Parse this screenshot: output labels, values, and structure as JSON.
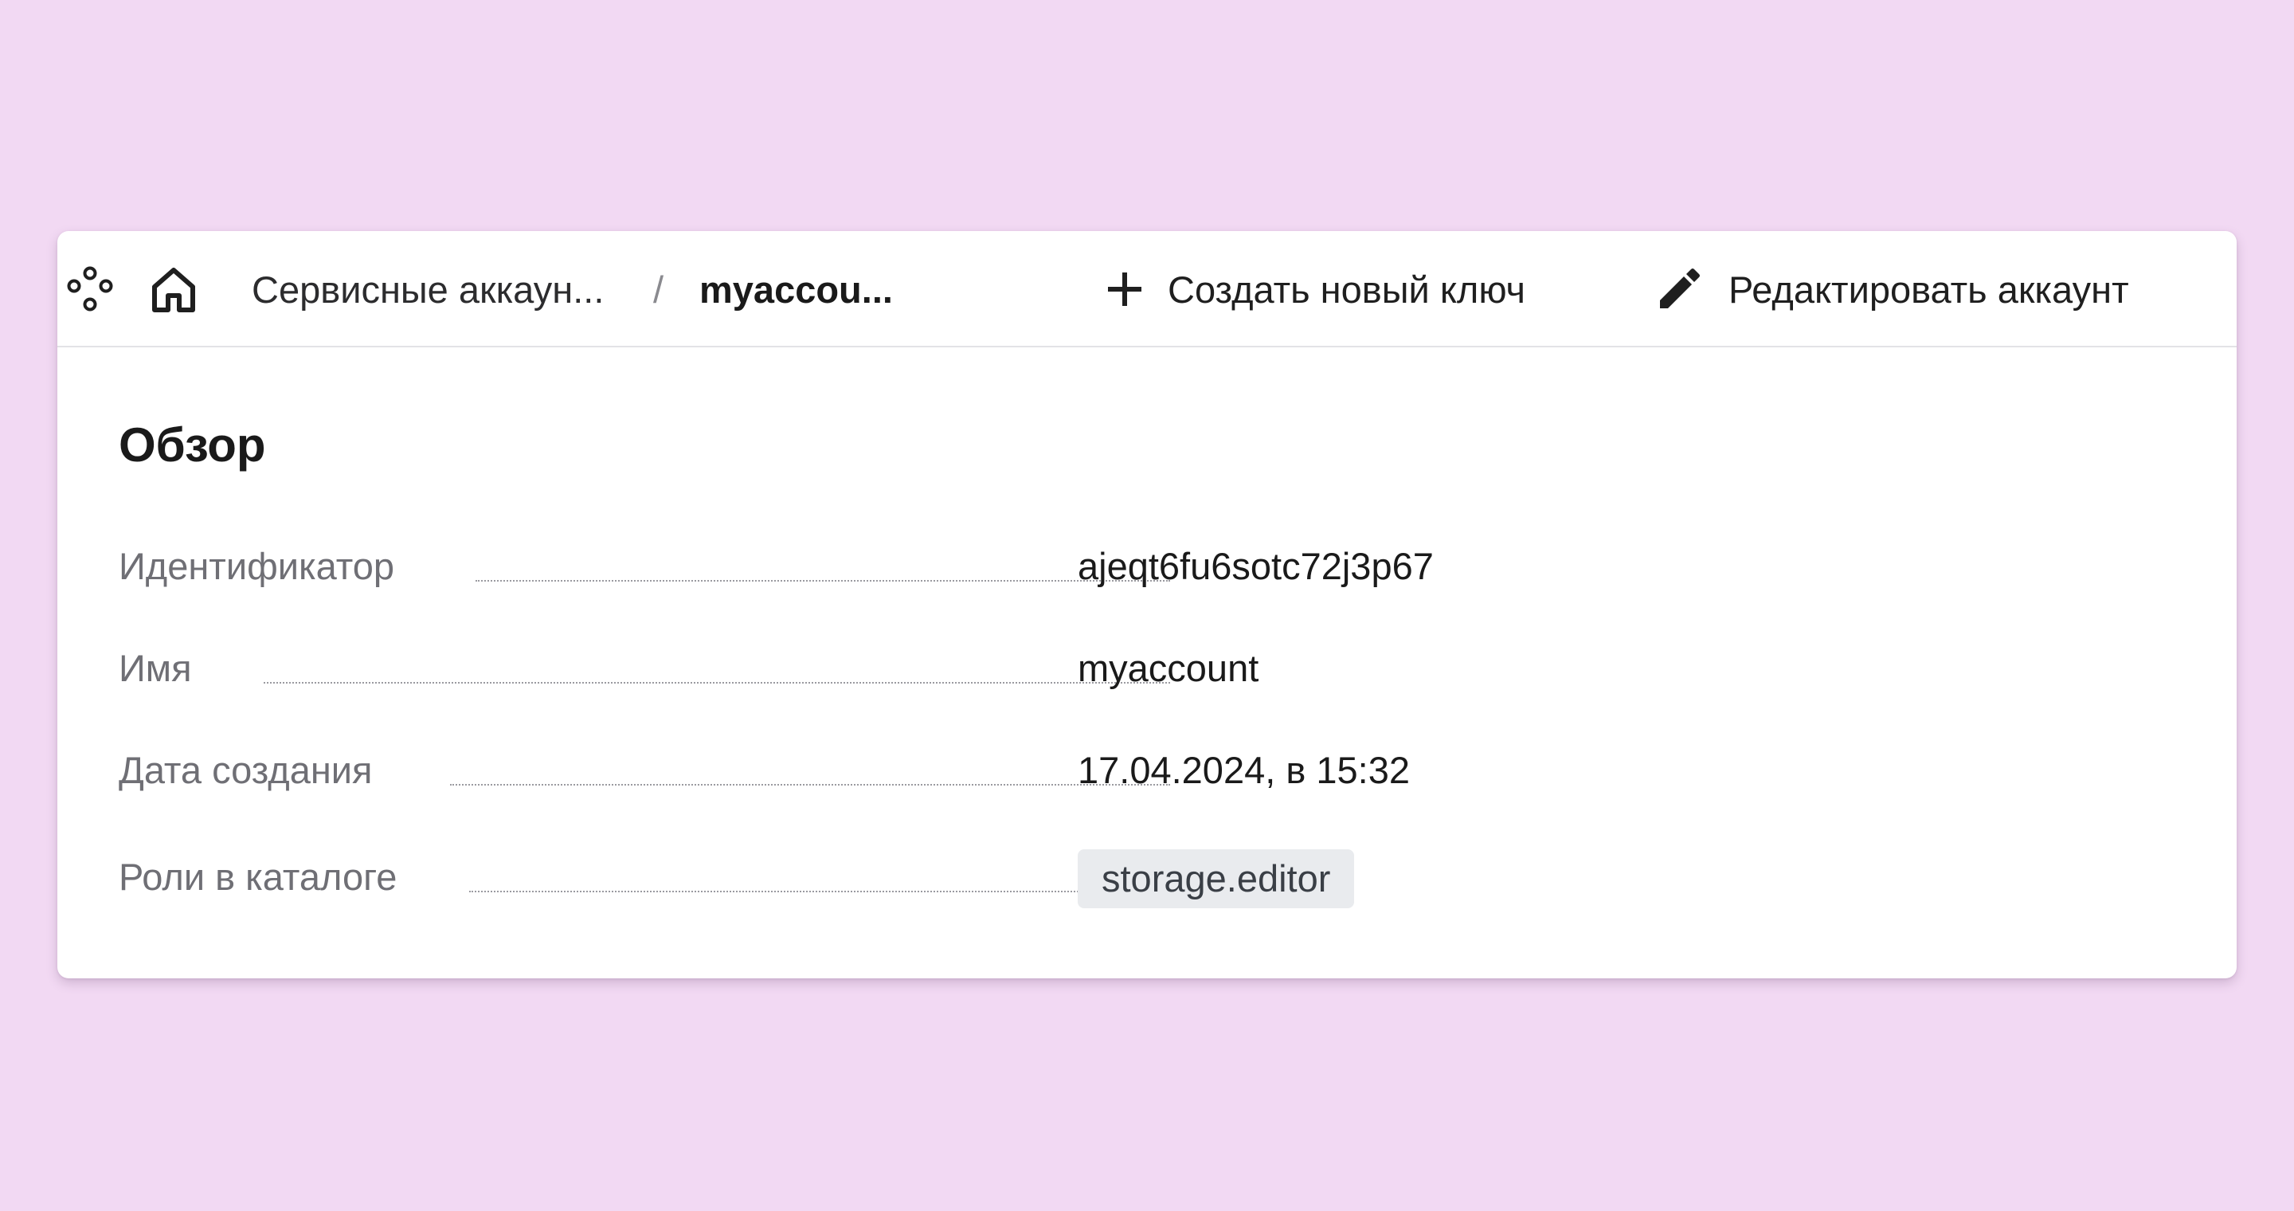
{
  "header": {
    "breadcrumb": {
      "parent": "Сервисные аккаун...",
      "separator": "/",
      "current": "myaccou..."
    },
    "actions": {
      "create_key": "Создать новый ключ",
      "edit_account": "Редактировать аккаунт"
    },
    "icons": [
      "services-icon",
      "home-icon",
      "plus-icon",
      "pencil-icon"
    ]
  },
  "overview": {
    "title": "Обзор",
    "fields": {
      "id": {
        "label": "Идентификатор",
        "value": "ajeqt6fu6sotc72j3p67"
      },
      "name": {
        "label": "Имя",
        "value": "myaccount"
      },
      "created": {
        "label": "Дата создания",
        "value": "17.04.2024, в 15:32"
      },
      "roles": {
        "label": "Роли в каталоге",
        "value": "storage.editor"
      }
    }
  },
  "colors": {
    "background": "#f2d9f3",
    "card": "#ffffff",
    "label": "#6f6f75",
    "chip": "#e9ebee"
  }
}
